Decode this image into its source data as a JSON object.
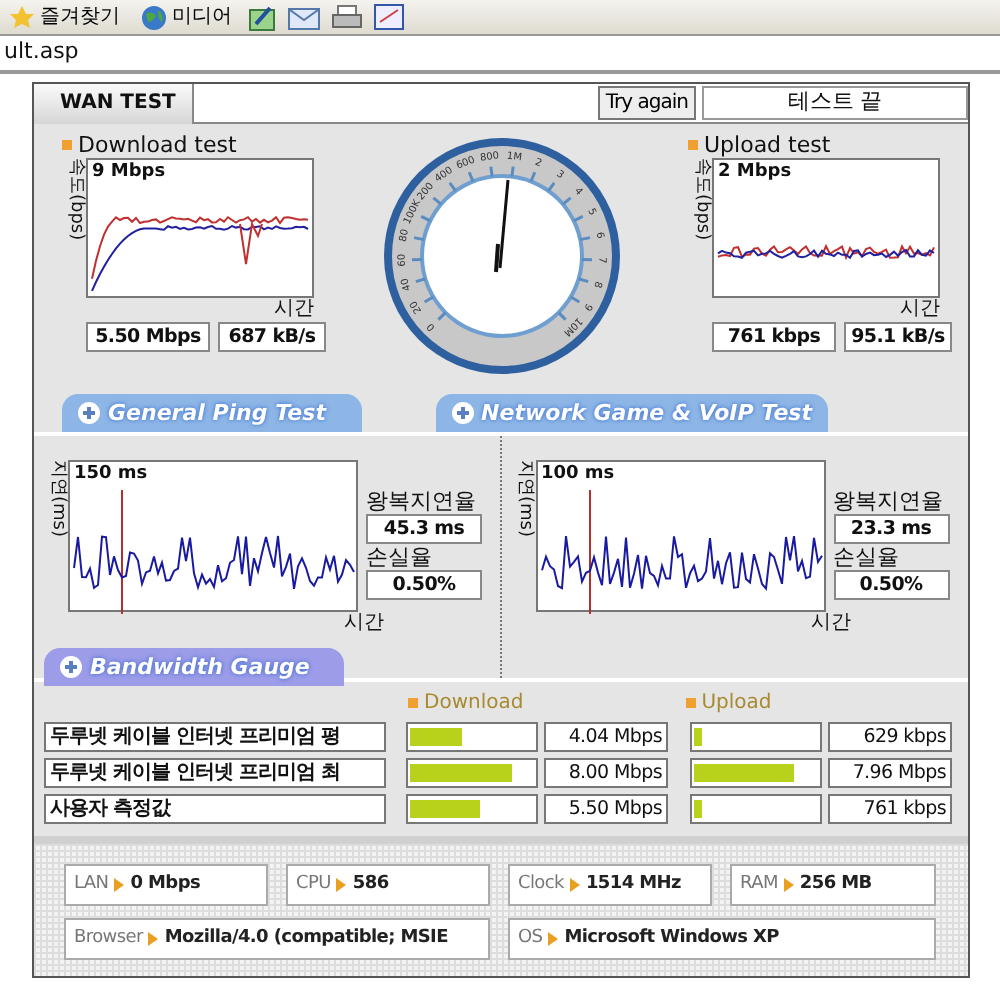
{
  "browser": {
    "toolbar": [
      {
        "label": "즐겨찾기"
      },
      {
        "label": "미디어"
      }
    ],
    "address": "ult.asp"
  },
  "tab": "WAN TEST",
  "try_again": "Try again",
  "status": "테스트 끝",
  "tests": [
    {
      "title": "Download test",
      "axis": "속도(bps)",
      "max": "9 Mbps",
      "time": "시간",
      "values": [
        "5.50 Mbps",
        "687 kB/s"
      ]
    },
    {
      "title": "Upload test",
      "axis": "속도(bps)",
      "max": "2 Mbps",
      "time": "시간",
      "values": [
        "761 kbps",
        "95.1 kB/s"
      ]
    }
  ],
  "gauge": {
    "labels": [
      "0",
      "20",
      "40",
      "60",
      "80",
      "100K",
      "200",
      "400",
      "600",
      "800",
      "1M",
      "2",
      "3",
      "4",
      "5",
      "6",
      "7",
      "8",
      "9",
      "10M"
    ]
  },
  "sections": [
    {
      "label": "General Ping Test",
      "color": "#8db6e6"
    },
    {
      "label": "Network Game & VoIP Test",
      "color": "#8db6e6"
    },
    {
      "label": "Bandwidth Gauge",
      "color": "#9c9ce8"
    }
  ],
  "ping": [
    {
      "axis": "지연(ms)",
      "max": "150 ms",
      "time": "시간",
      "rtt_label": "왕복지연율",
      "rtt": "45.3 ms",
      "loss_label": "손실율",
      "loss": "0.50%"
    },
    {
      "axis": "지연(ms)",
      "max": "100 ms",
      "time": "시간",
      "rtt_label": "왕복지연율",
      "rtt": "23.3 ms",
      "loss_label": "손실율",
      "loss": "0.50%"
    }
  ],
  "bandwidth": {
    "download_header": "Download",
    "upload_header": "Upload",
    "rows": [
      {
        "name": "두루넷 케이블 인터넷 프리미엄 평",
        "download": {
          "level": 0.42,
          "value": "4.04 Mbps"
        },
        "upload": {
          "level": 0.06,
          "value": "629 kbps"
        }
      },
      {
        "name": "두루넷 케이블 인터넷 프리미엄 최",
        "download": {
          "level": 0.83,
          "value": "8.00 Mbps"
        },
        "upload": {
          "level": 0.8,
          "value": "7.96 Mbps"
        }
      },
      {
        "name": "사용자 측정값",
        "download": {
          "level": 0.57,
          "value": "5.50 Mbps"
        },
        "upload": {
          "level": 0.06,
          "value": "761 kbps"
        }
      }
    ]
  },
  "system": [
    {
      "label": "LAN",
      "value": "0 Mbps"
    },
    {
      "label": "CPU",
      "value": "586"
    },
    {
      "label": "Clock",
      "value": "1514 MHz"
    },
    {
      "label": "RAM",
      "value": "256 MB"
    },
    {
      "label": "Browser",
      "value": "Mozilla/4.0 (compatible; MSIE"
    },
    {
      "label": "OS",
      "value": "Microsoft Windows XP"
    }
  ]
}
